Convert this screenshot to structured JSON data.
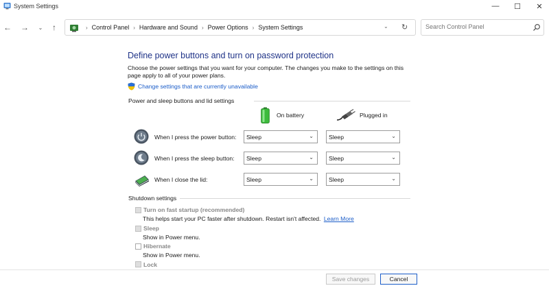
{
  "window": {
    "title": "System Settings",
    "controls": {
      "minimize": "—",
      "maximize": "☐",
      "close": "✕"
    }
  },
  "nav": {
    "back": "←",
    "forward": "→",
    "recent": "⌄",
    "up": "↑",
    "breadcrumbs": [
      "Control Panel",
      "Hardware and Sound",
      "Power Options",
      "System Settings"
    ],
    "separator": "›",
    "dropdown": "⌄",
    "refresh": "↻",
    "search_placeholder": "Search Control Panel"
  },
  "main": {
    "title": "Define power buttons and turn on password protection",
    "description": "Choose the power settings that you want for your computer. The changes you make to the settings on this page apply to all of your power plans.",
    "unavailable_link": "Change settings that are currently unavailable",
    "buttons_section": {
      "heading": "Power and sleep buttons and lid settings",
      "col_battery": "On battery",
      "col_plugged": "Plugged in",
      "rows": [
        {
          "label": "When I press the power button:",
          "battery": "Sleep",
          "plugged": "Sleep"
        },
        {
          "label": "When I press the sleep button:",
          "battery": "Sleep",
          "plugged": "Sleep"
        },
        {
          "label": "When I close the lid:",
          "battery": "Sleep",
          "plugged": "Sleep"
        }
      ]
    },
    "shutdown_section": {
      "heading": "Shutdown settings",
      "items": [
        {
          "label": "Turn on fast startup (recommended)",
          "note": "This helps start your PC faster after shutdown. Restart isn't affected.",
          "link": "Learn More",
          "checked": false,
          "disabled": true
        },
        {
          "label": "Sleep",
          "note": "Show in Power menu.",
          "checked": false,
          "disabled": true
        },
        {
          "label": "Hibernate",
          "note": "Show in Power menu.",
          "checked": false,
          "disabled": false
        },
        {
          "label": "Lock",
          "checked": false,
          "disabled": true
        }
      ]
    }
  },
  "footer": {
    "save": "Save changes",
    "cancel": "Cancel"
  },
  "colors": {
    "title_blue": "#1e3287",
    "link_blue": "#1a5cc8"
  }
}
